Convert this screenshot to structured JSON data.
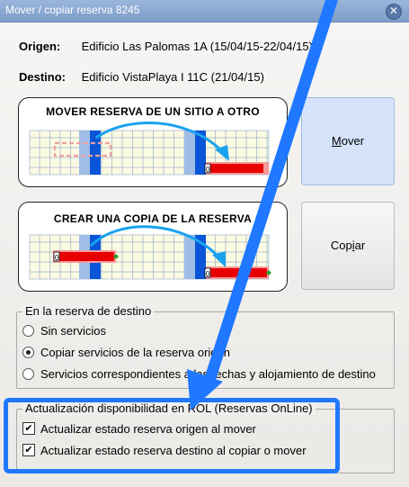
{
  "window": {
    "title": "Mover / copiar reserva 8245",
    "close_glyph": "✕"
  },
  "origen": {
    "label": "Origen:",
    "value": "Edificio Las Palomas 1A (15/04/15-22/04/15)"
  },
  "destino": {
    "label": "Destino:",
    "value": "Edificio VistaPlaya I 11C (21/04/15)"
  },
  "move_card": {
    "title": "MOVER RESERVA DE UN SITIO A OTRO",
    "marker": "0"
  },
  "copy_card": {
    "title": "CREAR UNA COPIA DE LA RESERVA",
    "marker": "0"
  },
  "buttons": {
    "mover": {
      "label_pre": "",
      "label_accel": "M",
      "label_post": "over"
    },
    "copiar": {
      "label_pre": "Cop",
      "label_accel": "i",
      "label_post": "ar"
    }
  },
  "destino_group": {
    "legend": "En la reserva de destino",
    "options": [
      {
        "label": "Sin servicios",
        "selected": false
      },
      {
        "label": "Copiar servicios de la reserva origen",
        "selected": true
      },
      {
        "label": "Servicios correspondientes a las fechas y alojamiento de destino",
        "selected": false
      }
    ]
  },
  "rol_group": {
    "legend": "Actualización disponibilidad en ROL  (Reservas OnLine)",
    "options": [
      {
        "label": "Actualizar estado reserva origen al mover",
        "checked": true
      },
      {
        "label": "Actualizar estado reserva destino al copiar o mover",
        "checked": true
      }
    ]
  },
  "colors": {
    "highlight_blue": "#1f78ff",
    "selected_button": "#d6e4fb",
    "reservation_red": "#e80000"
  },
  "icons": {
    "check": "✔"
  }
}
